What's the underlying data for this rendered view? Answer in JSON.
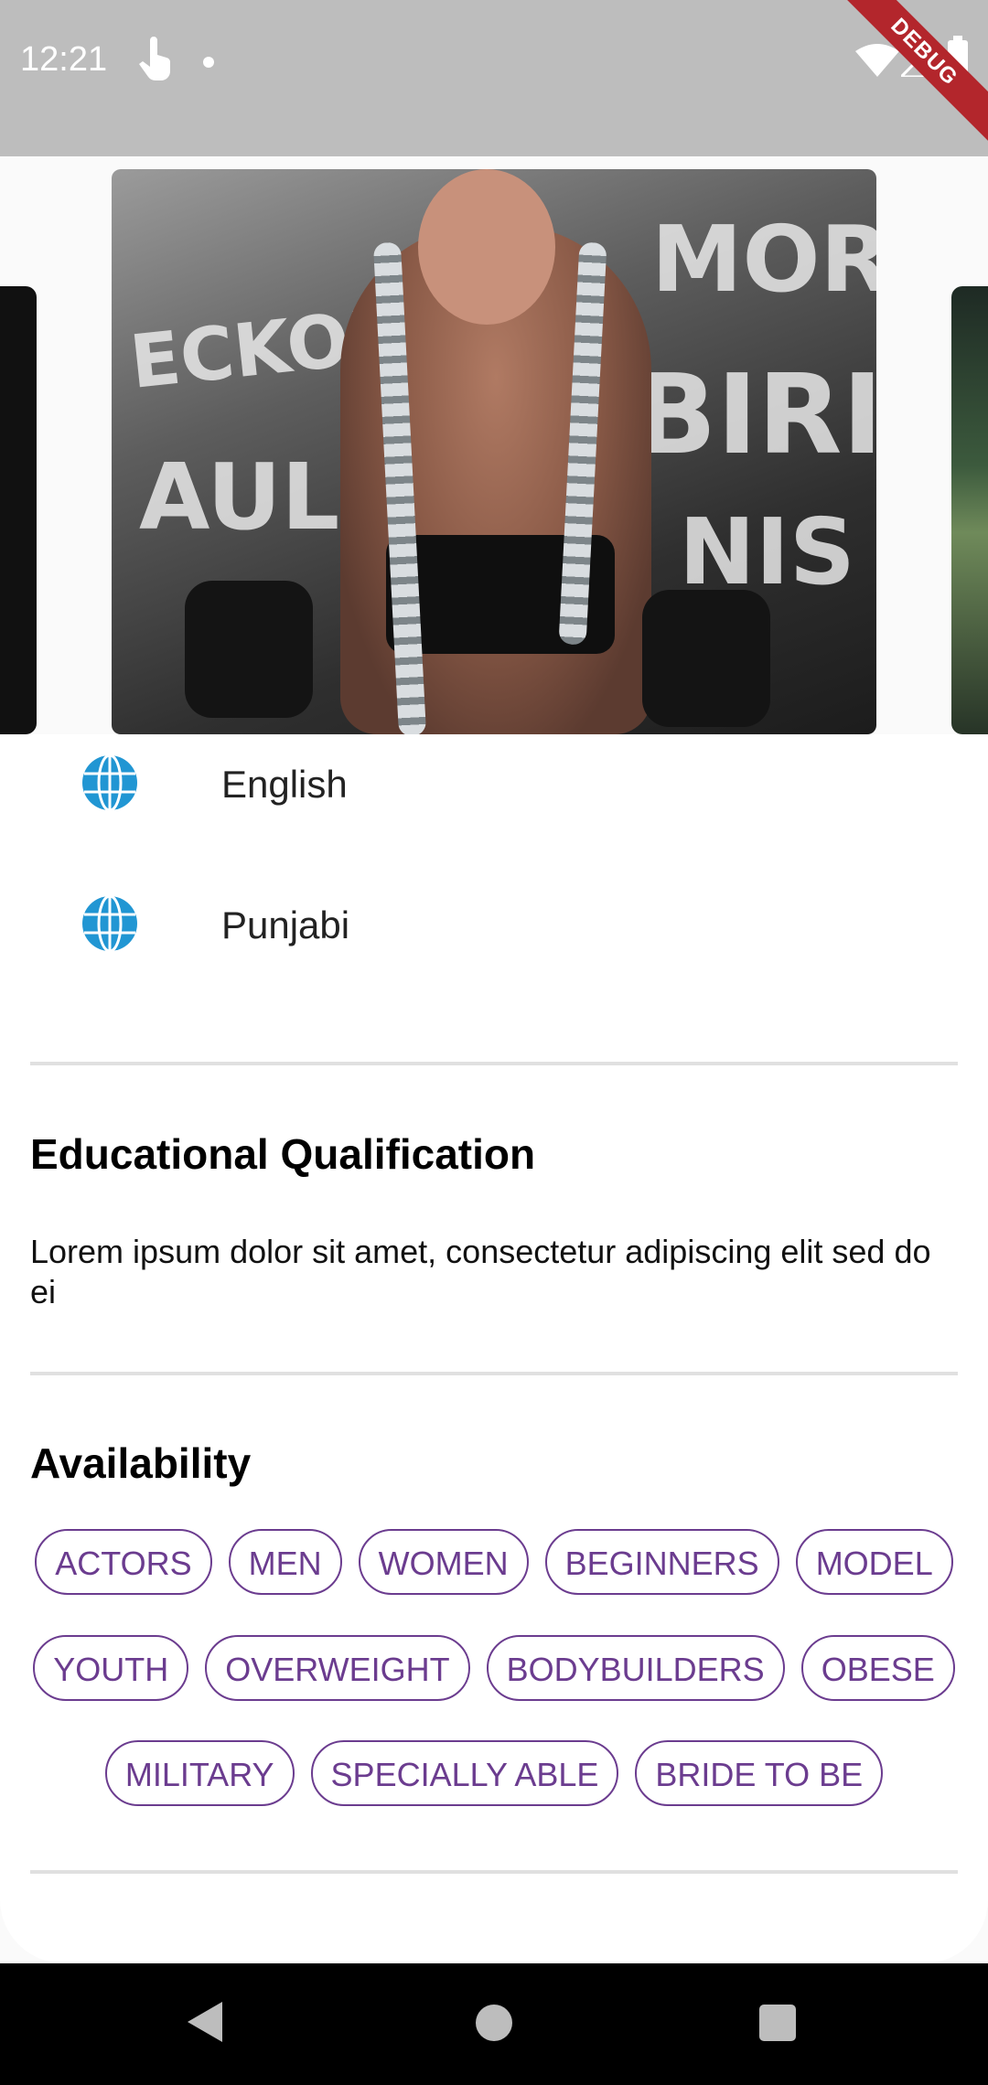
{
  "status_bar": {
    "time": "12:21",
    "debug_label": "DEBUG"
  },
  "carousel": {
    "page_count": 5,
    "active_index": 2,
    "graffiti_words": [
      "ECKOL",
      "MORT",
      "BIRI",
      "NIS",
      "AUL"
    ]
  },
  "languages": [
    {
      "label": "English",
      "icon": "globe-icon"
    },
    {
      "label": "Punjabi",
      "icon": "globe-icon"
    }
  ],
  "education": {
    "title": "Educational Qualification",
    "text": "Lorem ipsum dolor sit amet, consectetur adipiscing elit sed do ei"
  },
  "availability": {
    "title": "Availability",
    "rows": [
      [
        "ACTORS",
        "MEN",
        "WOMEN",
        "BEGINNERS",
        "MODEL"
      ],
      [
        "YOUTH",
        "OVERWEIGHT",
        "BODYBUILDERS",
        "OBESE"
      ],
      [
        "MILITARY",
        "SPECIALLY ABLE",
        "BRIDE TO BE"
      ]
    ]
  },
  "colors": {
    "accent": "#6b3c8f",
    "active_dot": "#7b3fa3",
    "globe": "#2196d3",
    "debug_ribbon": "#b3262c"
  }
}
